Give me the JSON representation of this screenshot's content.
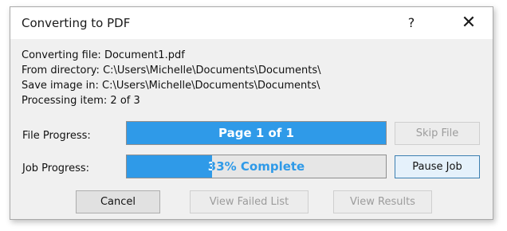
{
  "window": {
    "title": "Converting to PDF",
    "help_label": "?",
    "close_label": "✕"
  },
  "info": {
    "converting_file": "Converting file: Document1.pdf",
    "from_directory": "From directory: C:\\Users\\Michelle\\Documents\\Documents\\",
    "save_image_in": "Save image in: C:\\Users\\Michelle\\Documents\\Documents\\",
    "processing_item": "Processing item: 2 of 3"
  },
  "file_progress": {
    "label": "File Progress:",
    "text": "Page 1 of 1",
    "fraction": 1.0
  },
  "job_progress": {
    "label": "Job Progress:",
    "text": "33% Complete",
    "fraction": 0.33
  },
  "buttons": {
    "skip_file": "Skip File",
    "pause_job": "Pause Job",
    "cancel": "Cancel",
    "view_failed_list": "View Failed List",
    "view_results": "View Results"
  },
  "colors": {
    "progress_fill": "#2f9ae8",
    "progress_track": "#e6e6e6",
    "dialog_background": "#f0f0f0"
  }
}
